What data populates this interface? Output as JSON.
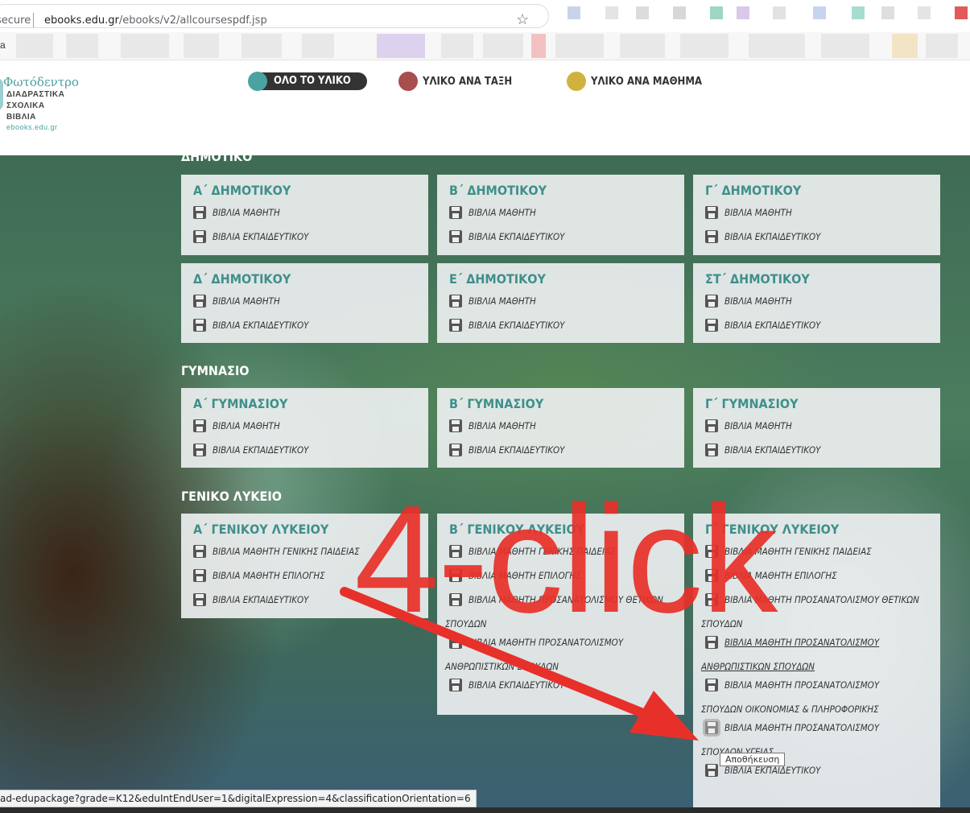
{
  "browser": {
    "secure_label": "secure",
    "url_host": "ebooks.edu.gr",
    "url_path": "/ebooks/v2/allcoursespdf.jsp",
    "bookmark_fragment": "a",
    "status_url": "ad-edupackage?grade=K12&eduIntEndUser=1&digitalExpression=4&classificationOrientation=6"
  },
  "logo": {
    "name": "Φωτόδεντρο",
    "line1": "ΔΙΑΔΡΑΣΤΙΚΑ",
    "line2": "ΣΧΟΛΙΚΑ",
    "line3": "ΒΙΒΛΙΑ",
    "site": "ebooks.edu.gr"
  },
  "nav": [
    {
      "label": "ΟΛΟ ΤΟ ΥΛΙΚΟ",
      "color": "#4aa3a3",
      "active": true
    },
    {
      "label": "ΥΛΙΚΟ ΑΝΑ ΤΑΞΗ",
      "color": "#a84e4e",
      "active": false
    },
    {
      "label": "ΥΛΙΚΟ ΑΝΑ ΜΑΘΗΜΑ",
      "color": "#d1b23f",
      "active": false
    }
  ],
  "sections": {
    "dimotiko": "ΔΗΜΟΤΙΚΟ",
    "gymnasio": "ΓΥΜΝΑΣΙΟ",
    "lykeio": "ΓΕΝΙΚΟ ΛΥΚΕΙΟ"
  },
  "cards": {
    "a_dim": {
      "title": "Α΄ ΔΗΜΟΤΙΚΟΥ",
      "r1": "ΒΙΒΛΙΑ ΜΑΘΗΤΗ",
      "r2": "ΒΙΒΛΙΑ ΕΚΠΑΙΔΕΥΤΙΚΟΥ"
    },
    "b_dim": {
      "title": "Β΄ ΔΗΜΟΤΙΚΟΥ",
      "r1": "ΒΙΒΛΙΑ ΜΑΘΗΤΗ",
      "r2": "ΒΙΒΛΙΑ ΕΚΠΑΙΔΕΥΤΙΚΟΥ"
    },
    "g_dim": {
      "title": "Γ΄ ΔΗΜΟΤΙΚΟΥ",
      "r1": "ΒΙΒΛΙΑ ΜΑΘΗΤΗ",
      "r2": "ΒΙΒΛΙΑ ΕΚΠΑΙΔΕΥΤΙΚΟΥ"
    },
    "d_dim": {
      "title": "Δ΄ ΔΗΜΟΤΙΚΟΥ",
      "r1": "ΒΙΒΛΙΑ ΜΑΘΗΤΗ",
      "r2": "ΒΙΒΛΙΑ ΕΚΠΑΙΔΕΥΤΙΚΟΥ"
    },
    "e_dim": {
      "title": "Ε΄ ΔΗΜΟΤΙΚΟΥ",
      "r1": "ΒΙΒΛΙΑ ΜΑΘΗΤΗ",
      "r2": "ΒΙΒΛΙΑ ΕΚΠΑΙΔΕΥΤΙΚΟΥ"
    },
    "st_dim": {
      "title": "ΣΤ΄ ΔΗΜΟΤΙΚΟΥ",
      "r1": "ΒΙΒΛΙΑ ΜΑΘΗΤΗ",
      "r2": "ΒΙΒΛΙΑ ΕΚΠΑΙΔΕΥΤΙΚΟΥ"
    },
    "a_gym": {
      "title": "Α΄ ΓΥΜΝΑΣΙΟΥ",
      "r1": "ΒΙΒΛΙΑ ΜΑΘΗΤΗ",
      "r2": "ΒΙΒΛΙΑ ΕΚΠΑΙΔΕΥΤΙΚΟΥ"
    },
    "b_gym": {
      "title": "Β΄ ΓΥΜΝΑΣΙΟΥ",
      "r1": "ΒΙΒΛΙΑ ΜΑΘΗΤΗ",
      "r2": "ΒΙΒΛΙΑ ΕΚΠΑΙΔΕΥΤΙΚΟΥ"
    },
    "g_gym": {
      "title": "Γ΄ ΓΥΜΝΑΣΙΟΥ",
      "r1": "ΒΙΒΛΙΑ ΜΑΘΗΤΗ",
      "r2": "ΒΙΒΛΙΑ ΕΚΠΑΙΔΕΥΤΙΚΟΥ"
    },
    "a_lyk": {
      "title": "Α΄ ΓΕΝΙΚΟΥ ΛΥΚΕΙΟΥ",
      "r1": "ΒΙΒΛΙΑ ΜΑΘΗΤΗ ΓΕΝΙΚΗΣ ΠΑΙΔΕΙΑΣ",
      "r2": "ΒΙΒΛΙΑ ΜΑΘΗΤΗ ΕΠΙΛΟΓΗΣ",
      "r3": "ΒΙΒΛΙΑ ΕΚΠΑΙΔΕΥΤΙΚΟΥ"
    },
    "b_lyk": {
      "title": "Β΄ ΓΕΝΙΚΟΥ ΛΥΚΕΙΟΥ",
      "r1": "ΒΙΒΛΙΑ ΜΑΘΗΤΗ ΓΕΝΙΚΗΣ ΠΑΙΔΕΙΑΣ",
      "r2": "ΒΙΒΛΙΑ ΜΑΘΗΤΗ ΕΠΙΛΟΓΗΣ",
      "r3a": "ΒΙΒΛΙΑ ΜΑΘΗΤΗ ΠΡΟΣΑΝΑΤΟΛΙΣΜΟΥ ΘΕΤΙΚΩΝ",
      "r3b": "ΣΠΟΥΔΩΝ",
      "r4a": "ΒΙΒΛΙΑ ΜΑΘΗΤΗ ΠΡΟΣΑΝΑΤΟΛΙΣΜΟΥ",
      "r4b": "ΑΝΘΡΩΠΙΣΤΙΚΩΝ ΣΠΟΥΔΩΝ",
      "r5": "ΒΙΒΛΙΑ ΕΚΠΑΙΔΕΥΤΙΚΟΥ"
    },
    "g_lyk": {
      "title": "Γ΄ ΓΕΝΙΚΟΥ ΛΥΚΕΙΟΥ",
      "r1": "ΒΙΒΛΙΑ ΜΑΘΗΤΗ ΓΕΝΙΚΗΣ ΠΑΙΔΕΙΑΣ",
      "r2": "ΒΙΒΛΙΑ ΜΑΘΗΤΗ ΕΠΙΛΟΓΗΣ",
      "r3a": "ΒΙΒΛΙΑ ΜΑΘΗΤΗ ΠΡΟΣΑΝΑΤΟΛΙΣΜΟΥ ΘΕΤΙΚΩΝ",
      "r3b": "ΣΠΟΥΔΩΝ",
      "r4a": "ΒΙΒΛΙΑ ΜΑΘΗΤΗ ΠΡΟΣΑΝΑΤΟΛΙΣΜΟΥ",
      "r4b": "ΑΝΘΡΩΠΙΣΤΙΚΩΝ ΣΠΟΥΔΩΝ",
      "r5a": "ΒΙΒΛΙΑ ΜΑΘΗΤΗ ΠΡΟΣΑΝΑΤΟΛΙΣΜΟΥ",
      "r5b": "ΣΠΟΥΔΩΝ ΟΙΚΟΝΟΜΙΑΣ & ΠΛΗΡΟΦΟΡΙΚΗΣ",
      "r6a": "ΒΙΒΛΙΑ ΜΑΘΗΤΗ ΠΡΟΣΑΝΑΤΟΛΙΣΜΟΥ",
      "r6b": "ΣΠΟΥΔΩΝ ΥΓΕΙΑΣ",
      "r7": "ΒΙΒΛΙΑ ΕΚΠΑΙΔΕΥΤΙΚΟΥ"
    }
  },
  "tooltip": "Αποθήκευση",
  "annotation": {
    "text": "4-click",
    "color": "#e8302a"
  }
}
